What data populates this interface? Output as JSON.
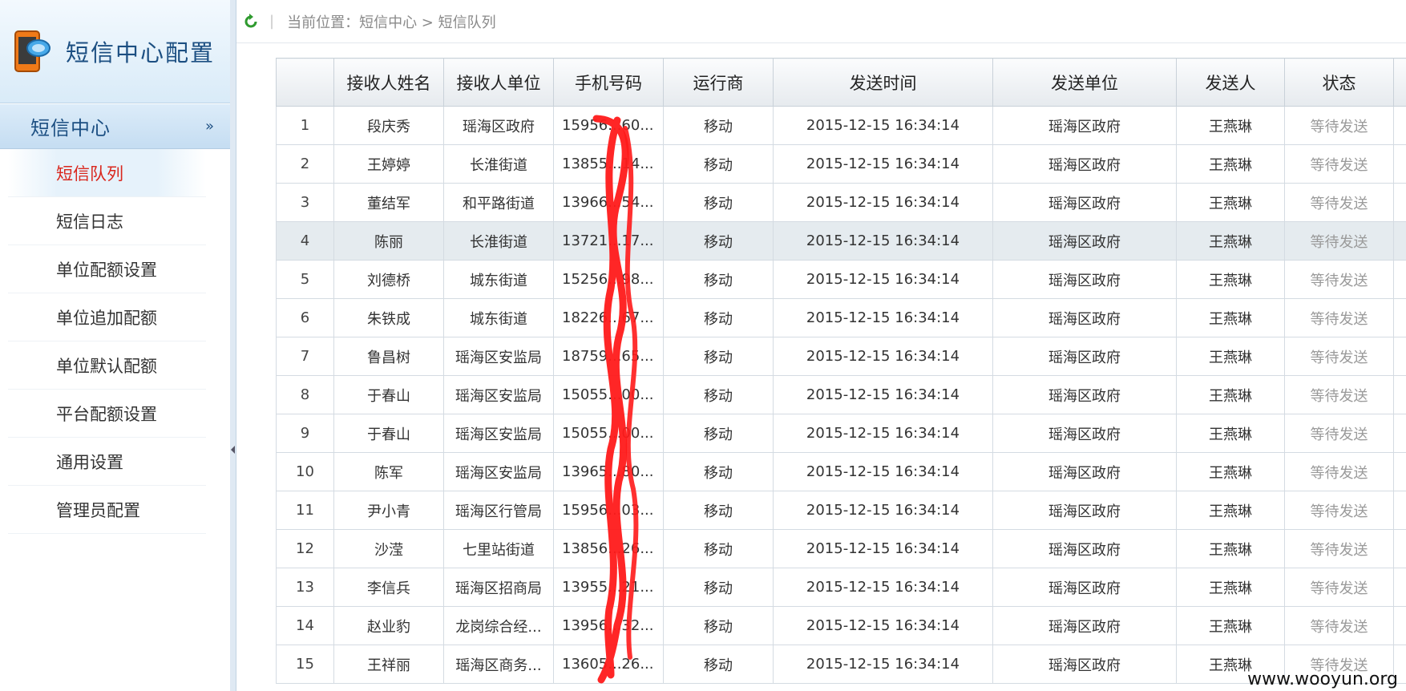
{
  "sidebar": {
    "app_title": "短信中心配置",
    "group_title": "短信中心",
    "items": [
      {
        "label": "短信队列",
        "active": true
      },
      {
        "label": "短信日志"
      },
      {
        "label": "单位配额设置"
      },
      {
        "label": "单位追加配额"
      },
      {
        "label": "单位默认配额"
      },
      {
        "label": "平台配额设置"
      },
      {
        "label": "通用设置"
      },
      {
        "label": "管理员配置"
      }
    ]
  },
  "topbar": {
    "breadcrumb": "当前位置：短信中心 > 短信队列"
  },
  "table": {
    "headers": [
      "",
      "接收人姓名",
      "接收人单位",
      "手机号码",
      "运行商",
      "发送时间",
      "发送单位",
      "发送人",
      "状态",
      ""
    ],
    "rows": [
      [
        "1",
        "段庆秀",
        "瑶海区政府",
        "15956...60...",
        "移动",
        "2015-12-15 16:34:14",
        "瑶海区政府",
        "王燕琳",
        "等待发送"
      ],
      [
        "2",
        "王婷婷",
        "长淮街道",
        "13855...14...",
        "移动",
        "2015-12-15 16:34:14",
        "瑶海区政府",
        "王燕琳",
        "等待发送"
      ],
      [
        "3",
        "董结军",
        "和平路街道",
        "13966...54...",
        "移动",
        "2015-12-15 16:34:14",
        "瑶海区政府",
        "王燕琳",
        "等待发送"
      ],
      [
        "4",
        "陈丽",
        "长淮街道",
        "13721...17...",
        "移动",
        "2015-12-15 16:34:14",
        "瑶海区政府",
        "王燕琳",
        "等待发送"
      ],
      [
        "5",
        "刘德桥",
        "城东街道",
        "15256...98...",
        "移动",
        "2015-12-15 16:34:14",
        "瑶海区政府",
        "王燕琳",
        "等待发送"
      ],
      [
        "6",
        "朱铁成",
        "城东街道",
        "18226...67...",
        "移动",
        "2015-12-15 16:34:14",
        "瑶海区政府",
        "王燕琳",
        "等待发送"
      ],
      [
        "7",
        "鲁昌树",
        "瑶海区安监局",
        "18759...65...",
        "移动",
        "2015-12-15 16:34:14",
        "瑶海区政府",
        "王燕琳",
        "等待发送"
      ],
      [
        "8",
        "于春山",
        "瑶海区安监局",
        "15055...00...",
        "移动",
        "2015-12-15 16:34:14",
        "瑶海区政府",
        "王燕琳",
        "等待发送"
      ],
      [
        "9",
        "于春山",
        "瑶海区安监局",
        "15055...00...",
        "移动",
        "2015-12-15 16:34:14",
        "瑶海区政府",
        "王燕琳",
        "等待发送"
      ],
      [
        "10",
        "陈军",
        "瑶海区安监局",
        "13965...80...",
        "移动",
        "2015-12-15 16:34:14",
        "瑶海区政府",
        "王燕琳",
        "等待发送"
      ],
      [
        "11",
        "尹小青",
        "瑶海区行管局",
        "15956...03...",
        "移动",
        "2015-12-15 16:34:14",
        "瑶海区政府",
        "王燕琳",
        "等待发送"
      ],
      [
        "12",
        "沙滢",
        "七里站街道",
        "13856...26...",
        "移动",
        "2015-12-15 16:34:14",
        "瑶海区政府",
        "王燕琳",
        "等待发送"
      ],
      [
        "13",
        "李信兵",
        "瑶海区招商局",
        "13955...21...",
        "移动",
        "2015-12-15 16:34:14",
        "瑶海区政府",
        "王燕琳",
        "等待发送"
      ],
      [
        "14",
        "赵业豹",
        "龙岗综合经...",
        "13956...32...",
        "移动",
        "2015-12-15 16:34:14",
        "瑶海区政府",
        "王燕琳",
        "等待发送"
      ],
      [
        "15",
        "王祥丽",
        "瑶海区商务...",
        "13605...26...",
        "移动",
        "2015-12-15 16:34:14",
        "瑶海区政府",
        "王燕琳",
        "等待发送"
      ]
    ]
  },
  "watermark": "www.wooyun.org",
  "colors": {
    "active_menu": "#d9261c",
    "brand_blue": "#1c4f82",
    "status_gray": "#9a9a9a",
    "scribble_red": "#ff1a1a"
  }
}
